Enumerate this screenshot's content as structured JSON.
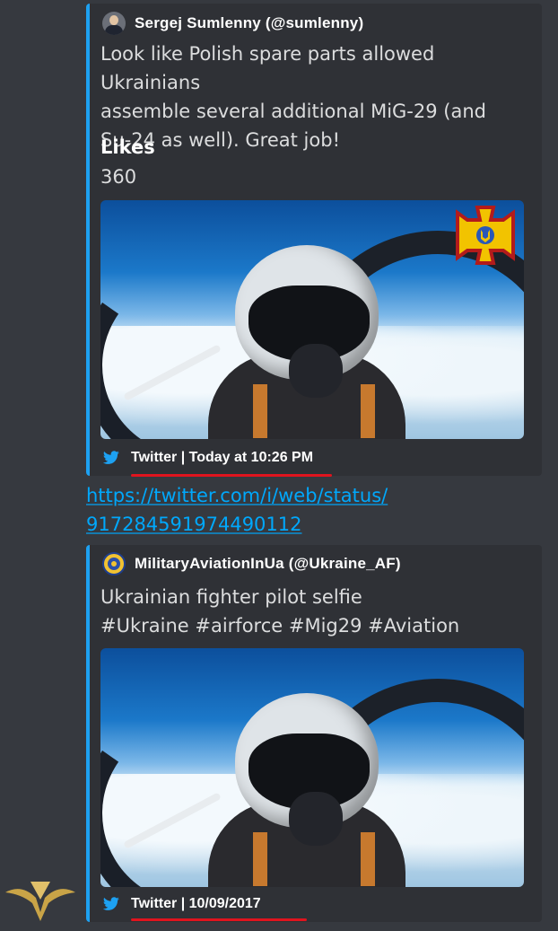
{
  "colors": {
    "accent_border": "#1da1f2",
    "link": "#00a8fc",
    "underline": "#e0141e"
  },
  "embed1": {
    "author": "Sergej Sumlenny (@sumlenny)",
    "avatar_icon": "person-avatar-icon",
    "description_lines": [
      "Look like Polish spare parts allowed Ukrainians",
      "assemble several additional MiG-29 (and",
      "Su-24 as well). Great job!"
    ],
    "field_name": "Likes",
    "field_value": "360",
    "footer": "Twitter | Today at 10:26 PM",
    "footer_icon": "twitter-bird-icon"
  },
  "link": {
    "lines": [
      "https://twitter.com/i/web/status/",
      "917284591974490112"
    ]
  },
  "embed2": {
    "author": "MilitaryAviationInUa (@Ukraine_AF)",
    "avatar_icon": "air-force-emblem-icon",
    "description_lines": [
      "Ukrainian fighter pilot selfie",
      "#Ukraine #airforce #Mig29 #Aviation"
    ],
    "footer": "Twitter | 10/09/2017",
    "footer_icon": "twitter-bird-icon"
  }
}
